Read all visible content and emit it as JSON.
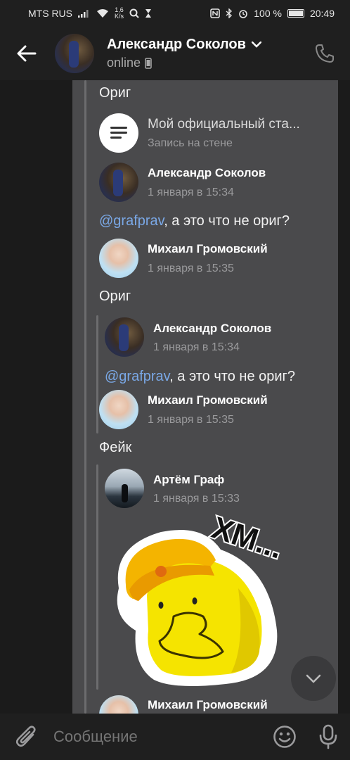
{
  "status_bar": {
    "carrier": "MTS RUS",
    "speed": "1,6",
    "speed_unit": "K/s",
    "battery": "100 %",
    "time": "20:49"
  },
  "header": {
    "name": "Александр Соколов",
    "status": "online"
  },
  "messages": {
    "orig1": "Ориг",
    "post_title": "Мой официальный ста...",
    "post_subtitle": "Запись на стене",
    "fwd1_name": "Александр Соколов",
    "fwd1_time": "1 января в 15:34",
    "fwd1_mention": "@grafprav",
    "fwd1_text": ", а это что не ориг?",
    "fwd2_name": "Михаил Громовский",
    "fwd2_time": "1 января в 15:35",
    "orig2": "Ориг",
    "fwd3_name": "Александр Соколов",
    "fwd3_time": "1 января в 15:34",
    "fwd3_mention": "@grafprav",
    "fwd3_text": ", а это что не ориг?",
    "fwd4_name": "Михаил Громовский",
    "fwd4_time": "1 января в 15:35",
    "fake": "Фейк",
    "fwd5_name": "Артём Граф",
    "fwd5_time": "1 января в 15:33",
    "sticker_text": "ХМ...",
    "fwd6_name": "Михаил Громовский"
  },
  "input": {
    "placeholder": "Сообщение"
  },
  "colors": {
    "mention": "#7aa8e6",
    "bubble": "#4a4a4c"
  }
}
